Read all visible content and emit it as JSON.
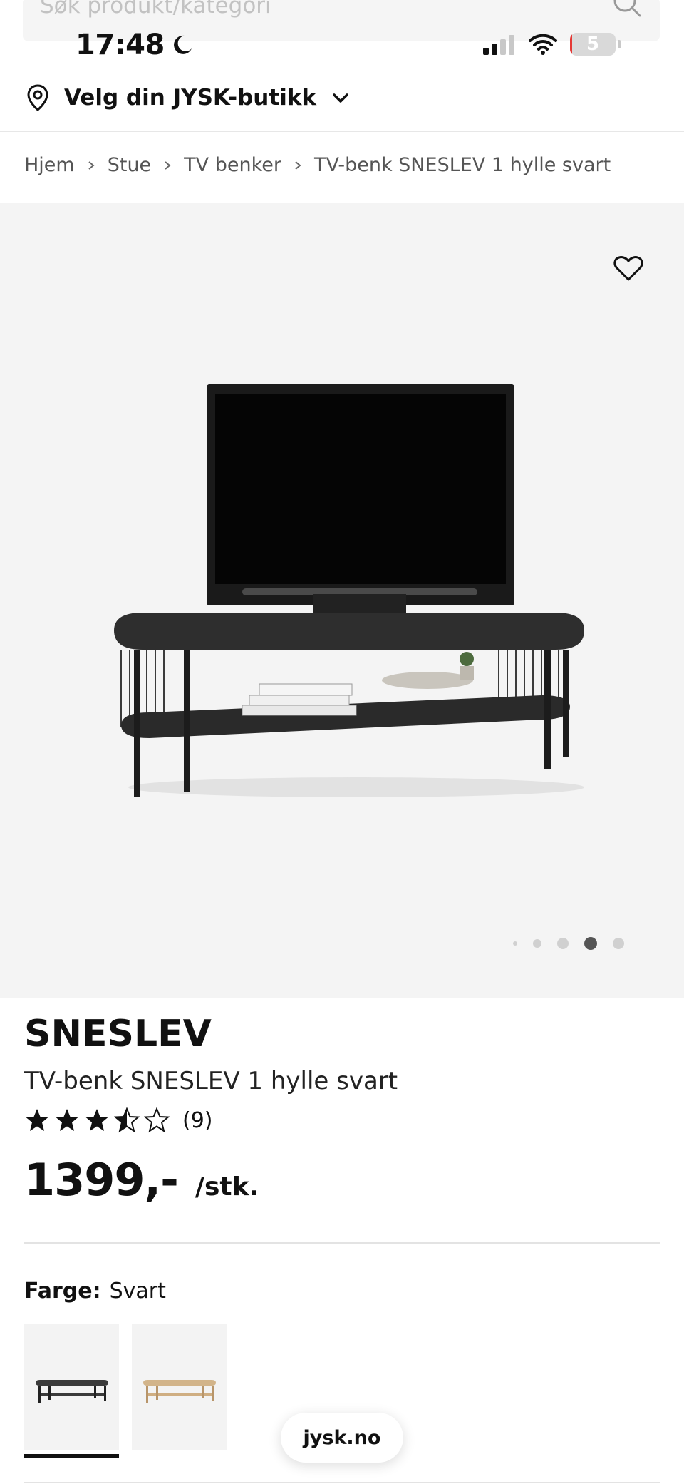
{
  "search": {
    "placeholder": "Søk produkt/kategori"
  },
  "status_bar": {
    "time": "17:48",
    "battery_level": "5",
    "battery_fraction": 0.05,
    "icons": [
      "moon-icon",
      "signal-icon",
      "wifi-icon",
      "battery-icon"
    ]
  },
  "store_selector": {
    "label": "Velg din JYSK-butikk",
    "icon": "location-pin-icon"
  },
  "breadcrumb": [
    "Hjem",
    "Stue",
    "TV benker",
    "TV-benk SNESLEV 1 hylle svart"
  ],
  "gallery": {
    "dot_count": 5,
    "active_dot": 3
  },
  "product": {
    "brand": "SNESLEV",
    "name": "TV-benk SNESLEV 1 hylle svart",
    "rating": 3.5,
    "review_count": "(9)",
    "price": "1399,-",
    "unit": "/stk."
  },
  "color_selector": {
    "key": "Farge:",
    "value": "Svart",
    "options": [
      "Svart",
      "Eik"
    ]
  },
  "site_pill": "jysk.no",
  "colors": {
    "accent": "#111111",
    "hero_bg": "#f4f4f4",
    "star": "#111111"
  }
}
